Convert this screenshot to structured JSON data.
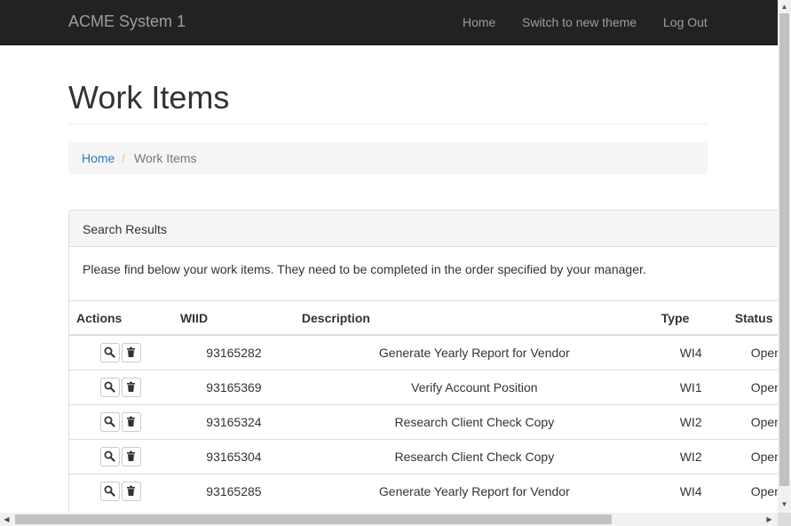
{
  "nav": {
    "brand": "ACME System 1",
    "links": [
      "Home",
      "Switch to new theme",
      "Log Out"
    ]
  },
  "page": {
    "title": "Work Items"
  },
  "breadcrumb": {
    "home": "Home",
    "separator": "/",
    "current": "Work Items"
  },
  "panel": {
    "heading": "Search Results",
    "text": "Please find below your work items. They need to be completed in the order specified by your manager."
  },
  "table": {
    "headers": [
      "Actions",
      "WIID",
      "Description",
      "Type",
      "Status"
    ],
    "rows": [
      {
        "wiid": "93165282",
        "description": "Generate Yearly Report for Vendor",
        "type": "WI4",
        "status": "Open"
      },
      {
        "wiid": "93165369",
        "description": "Verify Account Position",
        "type": "WI1",
        "status": "Open"
      },
      {
        "wiid": "93165324",
        "description": "Research Client Check Copy",
        "type": "WI2",
        "status": "Open"
      },
      {
        "wiid": "93165304",
        "description": "Research Client Check Copy",
        "type": "WI2",
        "status": "Open"
      },
      {
        "wiid": "93165285",
        "description": "Generate Yearly Report for Vendor",
        "type": "WI4",
        "status": "Open"
      }
    ]
  },
  "icons": {
    "view": "search-icon",
    "delete": "trash-icon"
  },
  "colors": {
    "navbar": "#222222",
    "link": "#337ab7",
    "muted": "#777777"
  }
}
